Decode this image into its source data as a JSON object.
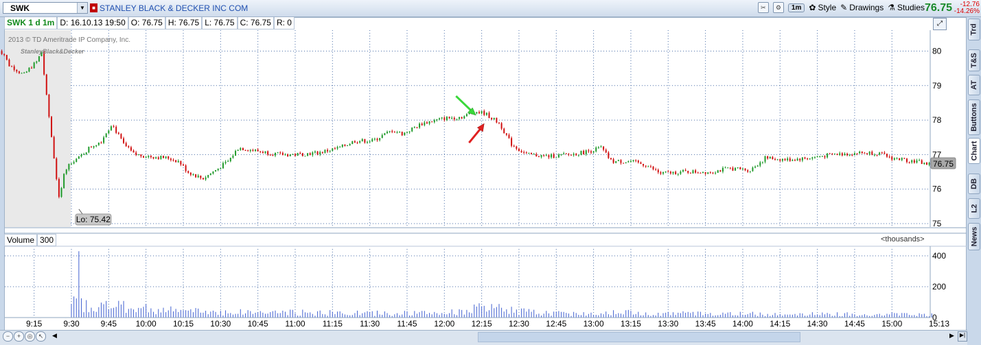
{
  "toolbar": {
    "symbol": "SWK",
    "company": "STANLEY BLACK & DECKER INC COM",
    "interval_btn": "1m",
    "style": "Style",
    "drawings": "Drawings",
    "studies": "Studies",
    "last_price": "76.75",
    "change": "-12.76",
    "change_pct": "-14.26%"
  },
  "info": {
    "title": "SWK 1 d 1m",
    "date": "D: 16.10.13 19:50",
    "open": "O: 76.75",
    "high": "H: 76.75",
    "low": "L: 76.75",
    "close": "C: 76.75",
    "range": "R: 0"
  },
  "watermark": {
    "copyright": "2013 © TD Ameritrade IP Company, Inc.",
    "logo": "StanleyBlack&Decker"
  },
  "price_axis": [
    "80",
    "79",
    "78",
    "77",
    "76",
    "75"
  ],
  "current_price_label": "76.75",
  "lo_label": "Lo: 75.42",
  "volume": {
    "label": "Volume",
    "value": "300",
    "units": "<thousands>",
    "axis": [
      "400",
      "200",
      "0"
    ]
  },
  "time_axis": [
    "9:15",
    "9:30",
    "9:45",
    "10:00",
    "10:15",
    "10:30",
    "10:45",
    "11:00",
    "11:15",
    "11:30",
    "11:45",
    "12:00",
    "12:15",
    "12:30",
    "12:45",
    "13:00",
    "13:15",
    "13:30",
    "13:45",
    "14:00",
    "14:15",
    "14:30",
    "14:45",
    "15:00",
    "15:13"
  ],
  "sidebar_tabs": [
    "Trd",
    "T&S",
    "AT",
    "Buttons",
    "Chart",
    "DB",
    "L2",
    "News"
  ],
  "colors": {
    "up": "#1f9a2a",
    "down": "#d01010",
    "premarket": "#e9e9e9",
    "grid": "#4a6ea8"
  },
  "chart_data": {
    "type": "candlestick",
    "price_range": [
      74.9,
      80.5
    ],
    "volume_range": [
      0,
      470
    ],
    "price_path": [
      [
        9.0,
        80.1
      ],
      [
        9.05,
        79.9
      ],
      [
        9.08,
        79.6
      ],
      [
        9.12,
        79.5
      ],
      [
        9.18,
        79.3
      ],
      [
        9.22,
        79.5
      ],
      [
        9.27,
        79.7
      ],
      [
        9.3,
        80.0
      ],
      [
        9.33,
        78.8
      ],
      [
        9.37,
        77.4
      ],
      [
        9.42,
        75.6
      ],
      [
        9.45,
        76.5
      ],
      [
        9.5,
        76.8
      ],
      [
        9.55,
        76.9
      ],
      [
        9.62,
        77.2
      ],
      [
        9.7,
        77.4
      ],
      [
        9.77,
        77.9
      ],
      [
        9.85,
        77.3
      ],
      [
        9.92,
        77.0
      ],
      [
        10.02,
        76.95
      ],
      [
        10.15,
        76.9
      ],
      [
        10.22,
        76.8
      ],
      [
        10.28,
        76.5
      ],
      [
        10.38,
        76.3
      ],
      [
        10.45,
        76.5
      ],
      [
        10.55,
        76.8
      ],
      [
        10.62,
        77.2
      ],
      [
        10.75,
        77.1
      ],
      [
        10.9,
        77.0
      ],
      [
        11.0,
        77.0
      ],
      [
        11.15,
        77.05
      ],
      [
        11.3,
        77.2
      ],
      [
        11.4,
        77.4
      ],
      [
        11.52,
        77.4
      ],
      [
        11.65,
        77.7
      ],
      [
        11.72,
        77.6
      ],
      [
        11.85,
        77.9
      ],
      [
        12.0,
        78.05
      ],
      [
        12.13,
        78.1
      ],
      [
        12.2,
        78.25
      ],
      [
        12.27,
        78.2
      ],
      [
        12.37,
        77.9
      ],
      [
        12.45,
        77.3
      ],
      [
        12.55,
        77.0
      ],
      [
        12.7,
        76.95
      ],
      [
        12.85,
        77.0
      ],
      [
        12.97,
        77.1
      ],
      [
        13.05,
        77.2
      ],
      [
        13.12,
        76.8
      ],
      [
        13.25,
        76.8
      ],
      [
        13.35,
        76.7
      ],
      [
        13.45,
        76.45
      ],
      [
        13.6,
        76.5
      ],
      [
        13.78,
        76.5
      ],
      [
        13.92,
        76.6
      ],
      [
        14.05,
        76.55
      ],
      [
        14.15,
        76.9
      ],
      [
        14.3,
        76.85
      ],
      [
        14.45,
        76.9
      ],
      [
        14.6,
        77.0
      ],
      [
        14.78,
        77.05
      ],
      [
        14.9,
        77.05
      ],
      [
        15.0,
        76.9
      ],
      [
        15.08,
        76.85
      ],
      [
        15.17,
        76.8
      ],
      [
        15.27,
        76.7
      ]
    ],
    "volume_profile": [
      [
        9.3,
        260
      ],
      [
        9.35,
        220
      ],
      [
        9.4,
        200
      ],
      [
        9.45,
        180
      ],
      [
        9.5,
        120
      ],
      [
        9.6,
        100
      ],
      [
        9.75,
        90
      ],
      [
        9.9,
        80
      ],
      [
        10.2,
        55
      ],
      [
        10.5,
        45
      ],
      [
        11.0,
        40
      ],
      [
        11.5,
        35
      ],
      [
        12.0,
        35
      ],
      [
        12.25,
        75
      ],
      [
        12.4,
        70
      ],
      [
        12.6,
        40
      ],
      [
        13.0,
        30
      ],
      [
        13.1,
        50
      ],
      [
        13.3,
        35
      ],
      [
        14.0,
        30
      ],
      [
        14.5,
        28
      ],
      [
        15.0,
        28
      ],
      [
        15.25,
        25
      ]
    ],
    "volume_spike": {
      "time": 9.55,
      "value": 430
    },
    "low": {
      "time": 9.55,
      "value": 75.42
    },
    "arrows": [
      {
        "color": "#3ad83a",
        "direction": "down-right"
      },
      {
        "color": "#e02020",
        "direction": "up-right"
      }
    ]
  }
}
